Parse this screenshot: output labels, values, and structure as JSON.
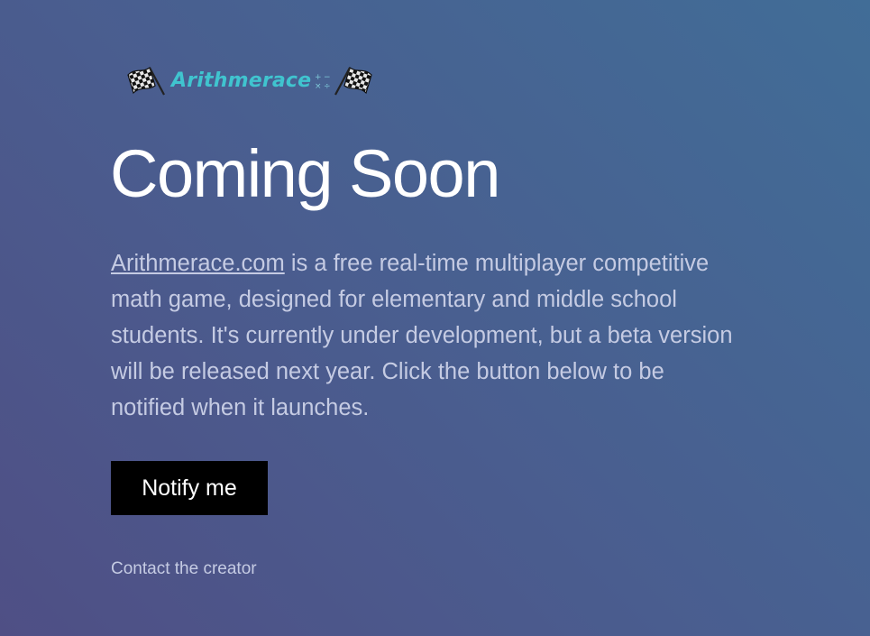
{
  "logo": {
    "text": "Arithmerace",
    "left_icon": "checkered-flag-icon",
    "right_icon": "checkered-flag-icon",
    "ops_icon": "math-operators-icon",
    "text_color": "#40c4cf"
  },
  "hero": {
    "title": "Coming Soon",
    "link_text": "Arithmerace.com",
    "description": " is a free real-time multiplayer competitive math game, designed for elementary and middle school students. It's currently under development, but a beta version will be released next year. Click the button below to be notified when it launches."
  },
  "actions": {
    "notify_label": "Notify me",
    "contact_label": "Contact the creator"
  },
  "colors": {
    "background_start": "#4f4f85",
    "background_end": "#416d97",
    "button_bg": "#000000",
    "text_muted": "#c5cbe3"
  }
}
